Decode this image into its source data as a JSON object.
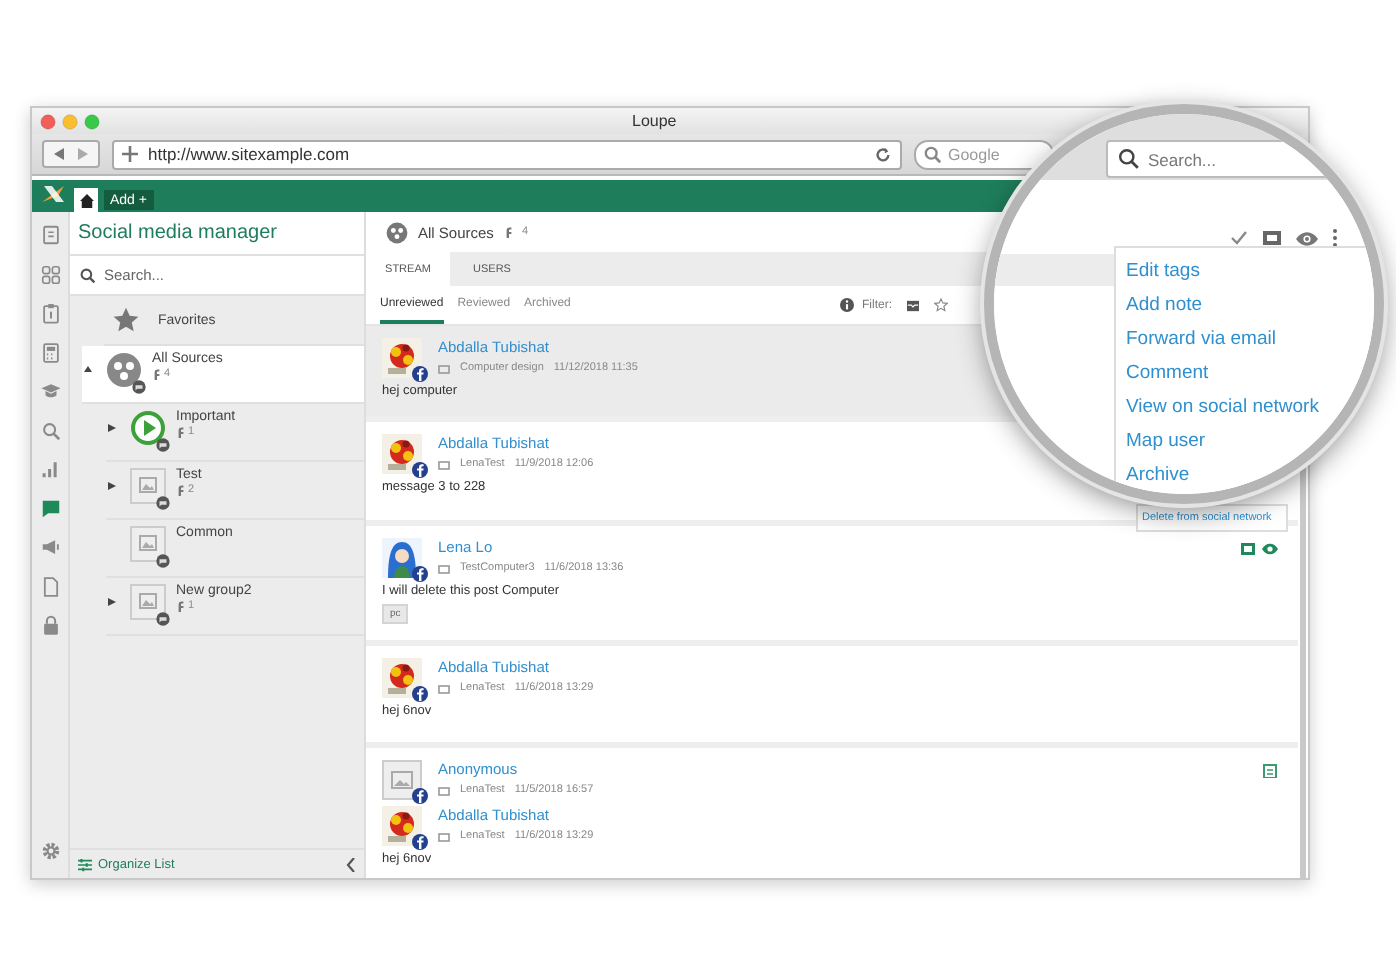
{
  "browser": {
    "title": "Loupe",
    "url": "http://www.sitexample.com",
    "search_placeholder": "Google"
  },
  "app_bar": {
    "add_button": "Add +"
  },
  "rail": [
    {
      "selected": false
    },
    {
      "selected": false
    },
    {
      "selected": false
    },
    {
      "selected": false
    },
    {
      "selected": false
    },
    {
      "selected": false
    },
    {
      "selected": false
    },
    {
      "selected": true
    },
    {
      "selected": false
    },
    {
      "selected": false
    },
    {
      "selected": false
    }
  ],
  "sidebar": {
    "title": "Social media manager",
    "search_placeholder": "Search...",
    "favorites": "Favorites",
    "tree": [
      {
        "label": "All Sources",
        "count": "4",
        "kind": "sources",
        "selected": true,
        "expanded": true,
        "children": [
          {
            "label": "Important",
            "count": "1",
            "kind": "play",
            "selected": false,
            "expanded": false
          },
          {
            "label": "Test",
            "count": "2",
            "kind": "image",
            "selected": false,
            "expanded": false
          },
          {
            "label": "Common",
            "kind": "image",
            "selected": false
          },
          {
            "label": "New group2",
            "count": "1",
            "kind": "image",
            "selected": false,
            "expanded": false
          }
        ]
      }
    ],
    "footer": "Organize List"
  },
  "main": {
    "title": "All Sources",
    "count": "4",
    "tabs": [
      {
        "label": "STREAM",
        "selected": true
      },
      {
        "label": "USERS",
        "selected": false
      }
    ],
    "subtabs": [
      {
        "label": "Unreviewed",
        "selected": true
      },
      {
        "label": "Reviewed",
        "selected": false
      },
      {
        "label": "Archived",
        "selected": false
      }
    ],
    "filter": "Filter:",
    "posts": [
      {
        "selected": true,
        "entries": [
          {
            "kind": "flower",
            "author": "Abdalla Tubishat",
            "source": "Computer design",
            "time": "11/12/2018 11:35",
            "text": "hej computer"
          }
        ]
      },
      {
        "selected": false,
        "entries": [
          {
            "kind": "flower",
            "author": "Abdalla Tubishat",
            "source": "LenaTest",
            "time": "11/9/2018 12:06",
            "text": "message 3 to 228"
          }
        ]
      },
      {
        "selected": false,
        "actions": [
          {
            "kind": "box"
          },
          {
            "kind": "eye"
          }
        ],
        "entries": [
          {
            "kind": "figure",
            "author": "Lena Lo",
            "source": "TestComputer3",
            "time": "11/6/2018 13:36",
            "text": "I will delete this post Computer",
            "tag": "pc"
          }
        ]
      },
      {
        "selected": false,
        "entries": [
          {
            "kind": "flower",
            "author": "Abdalla Tubishat",
            "source": "LenaTest",
            "time": "11/6/2018 13:29",
            "text": "hej 6nov"
          }
        ]
      },
      {
        "selected": false,
        "actions": [
          {
            "kind": "note"
          }
        ],
        "entries": [
          {
            "kind": "blank",
            "author": "Anonymous",
            "source": "LenaTest",
            "time": "11/5/2018 16:57"
          },
          {
            "kind": "flower",
            "author": "Abdalla Tubishat",
            "source": "LenaTest",
            "time": "11/6/2018 13:29",
            "text": "hej 6nov"
          }
        ]
      }
    ],
    "menu": [
      "Delete from social network"
    ]
  },
  "magnifier": {
    "search_placeholder": "Search...",
    "menu": [
      "Edit tags",
      "Add note",
      "Forward via email",
      "Comment",
      "View on social network",
      "Map user",
      "Archive"
    ]
  }
}
